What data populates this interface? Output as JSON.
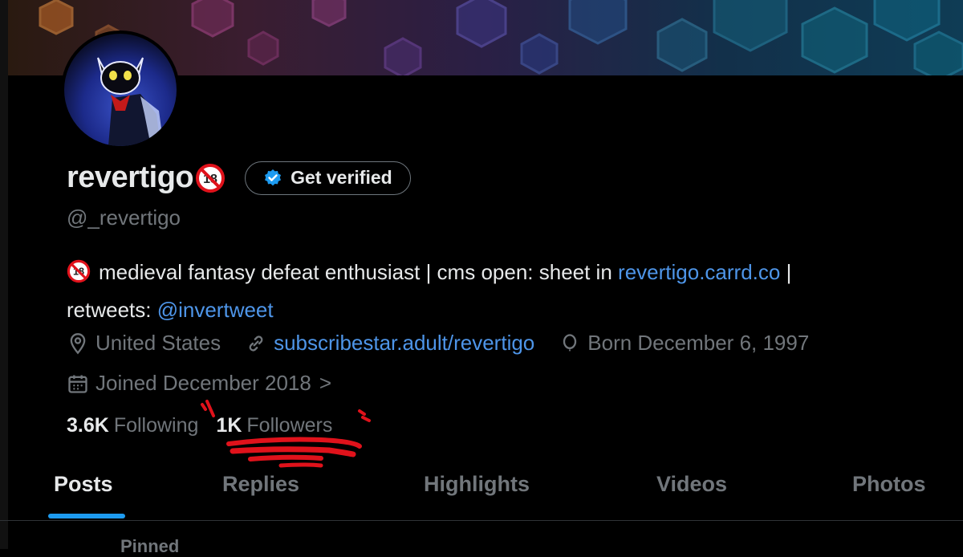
{
  "profile": {
    "display_name": "revertigo",
    "adult_badge": "18",
    "handle": "@_revertigo",
    "bio_text": "medieval fantasy defeat enthusiast | cms open: sheet in ",
    "bio_link": "revertigo.carrd.co",
    "bio_sep": " |",
    "bio_line2_prefix": "retweets: ",
    "bio_mention": "@invertweet",
    "location": "United States",
    "website": "subscribestar.adult/revertigo",
    "birthday": "Born December 6, 1997",
    "joined": "Joined December 2018",
    "joined_chevron": ">"
  },
  "verify_button": {
    "label": "Get verified"
  },
  "stats": {
    "following_count": "3.6K",
    "following_label": "Following",
    "followers_count": "1K",
    "followers_label": "Followers"
  },
  "tabs": [
    {
      "label": "Posts",
      "active": true
    },
    {
      "label": "Replies",
      "active": false
    },
    {
      "label": "Highlights",
      "active": false
    },
    {
      "label": "Videos",
      "active": false
    },
    {
      "label": "Photos",
      "active": false
    }
  ],
  "pinned_label": "Pinned",
  "colors": {
    "accent": "#1d9bf0",
    "link": "#4e95e8",
    "muted": "#71767b",
    "annotation": "#e0121b"
  }
}
